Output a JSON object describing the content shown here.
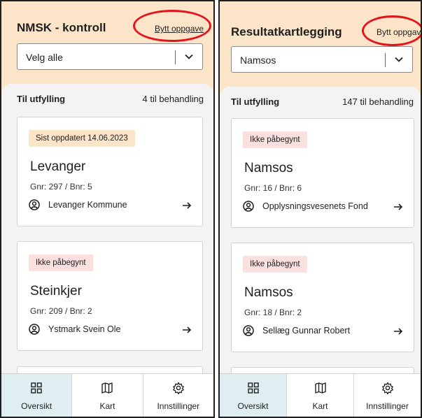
{
  "left": {
    "title": "NMSK - kontroll",
    "switch_label": "Bytt oppgave",
    "select_value": "Velg alle",
    "list_header": "Til utfylling",
    "count": "4 til behandling",
    "cards": [
      {
        "badge": "Sist oppdatert 14.06.2023",
        "place": "Levanger",
        "gnr": "Gnr: 297 / Bnr: 5",
        "owner": "Levanger Kommune"
      },
      {
        "badge": "Ikke påbegynt",
        "place": "Steinkjer",
        "gnr": "Gnr: 209 / Bnr: 2",
        "owner": "Ystmark Svein Ole"
      }
    ]
  },
  "right": {
    "title": "Resultatkartlegging",
    "switch_label": "Bytt oppgave",
    "select_value": "Namsos",
    "list_header": "Til utfylling",
    "count": "147 til behandling",
    "cards": [
      {
        "badge": "Ikke påbegynt",
        "place": "Namsos",
        "gnr": "Gnr: 16 / Bnr: 6",
        "owner": "Opplysningsvesenets Fond"
      },
      {
        "badge": "Ikke påbegynt",
        "place": "Namsos",
        "gnr": "Gnr: 18 / Bnr: 2",
        "owner": "Sellæg Gunnar Robert"
      }
    ]
  },
  "nav": {
    "overview": "Oversikt",
    "map": "Kart",
    "settings": "Innstillinger"
  },
  "colors": {
    "header_bg": "#fbe4c8",
    "badge_updated_bg": "#fbe4c8",
    "badge_notstarted_bg": "#fbe0e0",
    "nav_active_bg": "#dfeff1",
    "highlight_oval": "#e3141c"
  },
  "icons": {
    "owner": "person-circle-icon",
    "arrow": "arrow-right-icon",
    "select": "chevron-down-icon",
    "overview": "grid-icon",
    "map": "map-icon",
    "settings": "gear-icon"
  }
}
